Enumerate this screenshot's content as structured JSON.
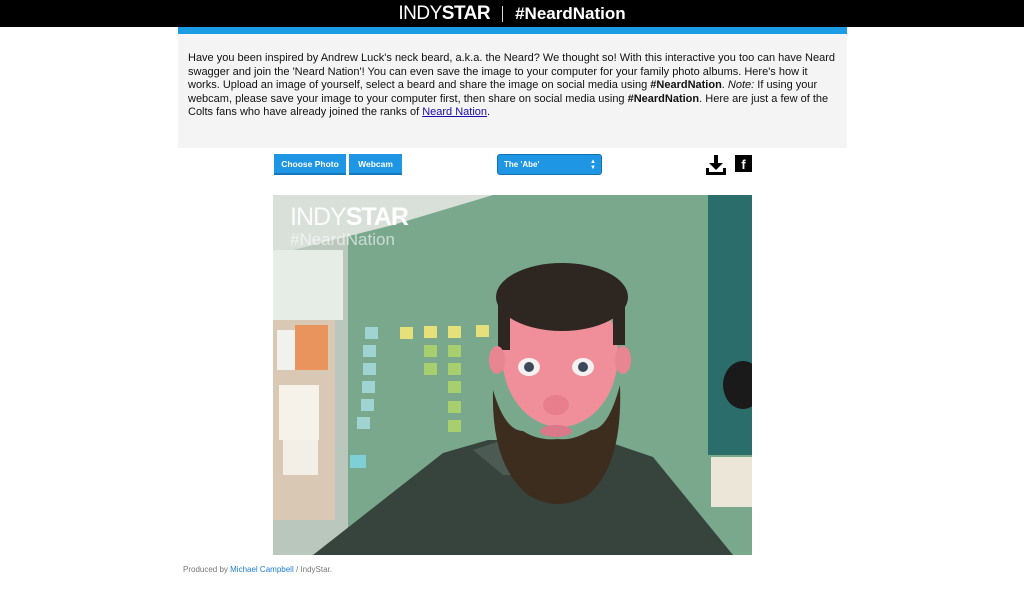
{
  "header": {
    "logo_indy": "INDY",
    "logo_star": "STAR",
    "hashtag": "#NeardNation"
  },
  "intro": {
    "p1": "Have you been inspired by Andrew Luck's neck beard, a.k.a. the Neard? We thought so! With this interactive you too can have Neard swagger and join the 'Neard Nation'! You can even save the image to your computer for your family photo albums. Here's how it works. Upload an image of yourself, select a beard and share the image on social media using ",
    "hashtag1": "#NeardNation",
    "p2": ". ",
    "note_label": "Note:",
    "p3": " If using your webcam, please save your image to your computer first, then share on social media using ",
    "hashtag2": "#NeardNation",
    "p4": ". Here are just a few of the Colts fans who have already joined the ranks of ",
    "link": "Neard Nation",
    "p5": "."
  },
  "controls": {
    "choose_photo": "Choose Photo",
    "webcam": "Webcam",
    "beard_selected": "The 'Abe'"
  },
  "icons": {
    "download": "download-icon",
    "facebook": "facebook-icon",
    "facebook_glyph": "f"
  },
  "photo": {
    "watermark_indy": "INDY",
    "watermark_star": "STAR",
    "watermark_tag": "#NeardNation"
  },
  "footer": {
    "prefix": "Produced by ",
    "author": "Michael Campbell",
    "suffix": " / IndyStar."
  },
  "colors": {
    "accent": "#1e96e3",
    "topbar": "#000000"
  }
}
